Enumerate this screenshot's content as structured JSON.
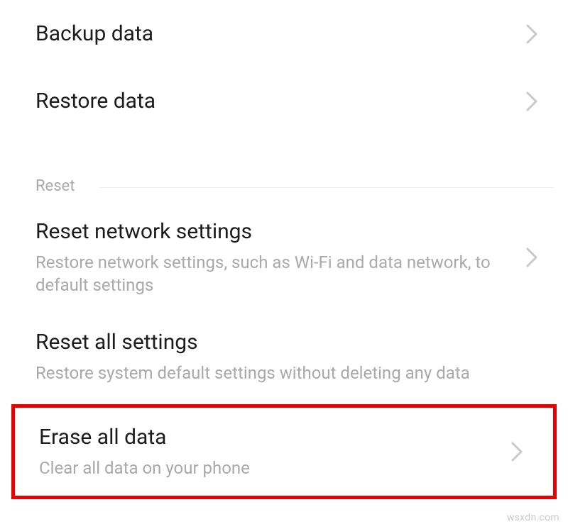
{
  "items": {
    "backup": {
      "title": "Backup data"
    },
    "restore": {
      "title": "Restore data"
    }
  },
  "section": {
    "label": "Reset"
  },
  "reset": {
    "network": {
      "title": "Reset network settings",
      "subtitle": "Restore network settings, such as Wi-Fi and data network, to default settings"
    },
    "all_settings": {
      "title": "Reset all settings",
      "subtitle": "Restore system default settings without deleting any data"
    },
    "erase": {
      "title": "Erase all data",
      "subtitle": "Clear all data on your phone"
    }
  },
  "watermark": "wsxdn.com"
}
